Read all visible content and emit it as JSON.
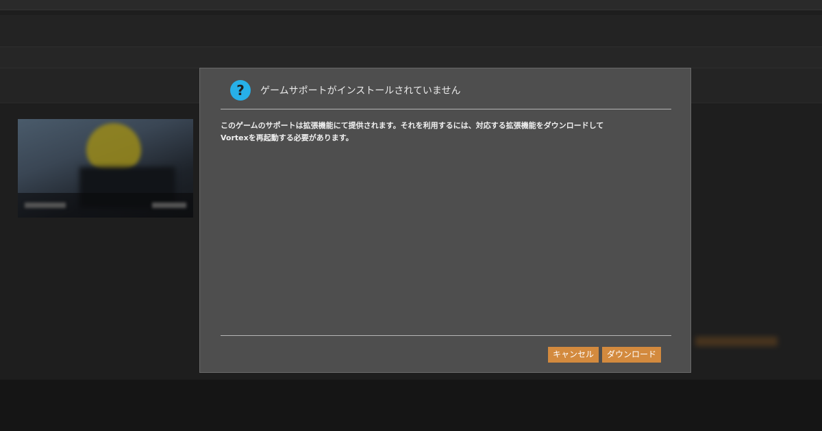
{
  "dialog": {
    "icon": "question-icon",
    "icon_glyph": "?",
    "title": "ゲームサポートがインストールされていません",
    "message": "このゲームのサポートは拡張機能にて提供されます。それを利用するには、対応する拡張機能をダウンロードして\nVortexを再起動する必要があります。",
    "buttons": {
      "cancel_label": "キャンセル",
      "download_label": "ダウンロード"
    }
  },
  "colors": {
    "accent_button": "#d38a3e",
    "icon_blue": "#27b0e8",
    "dialog_background": "#4e4e4e"
  }
}
